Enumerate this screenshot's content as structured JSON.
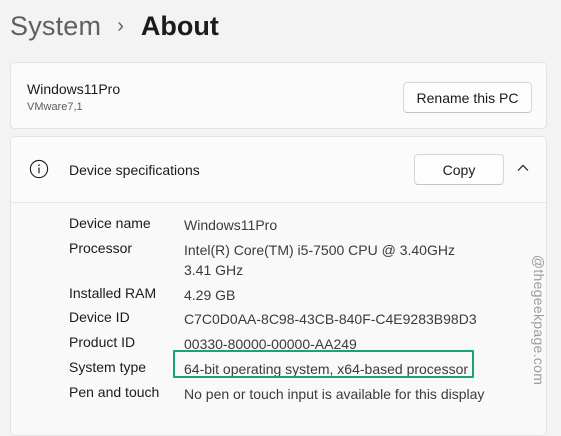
{
  "breadcrumb": {
    "parent": "System",
    "separator": "›",
    "current": "About"
  },
  "pc": {
    "name": "Windows11Pro",
    "model": "VMware7,1",
    "rename_label": "Rename this PC"
  },
  "device_specs": {
    "title": "Device specifications",
    "copy_label": "Copy",
    "rows": [
      {
        "label": "Device name",
        "value": "Windows11Pro"
      },
      {
        "label": "Processor",
        "value": "Intel(R) Core(TM) i5-7500 CPU @ 3.40GHz   3.41 GHz"
      },
      {
        "label": "Installed RAM",
        "value": "4.29 GB"
      },
      {
        "label": "Device ID",
        "value": "C7C0D0AA-8C98-43CB-840F-C4E9283B98D3"
      },
      {
        "label": "Product ID",
        "value": "00330-80000-00000-AA249"
      },
      {
        "label": "System type",
        "value": "64-bit operating system, x64-based processor"
      },
      {
        "label": "Pen and touch",
        "value": "No pen or touch input is available for this display"
      }
    ]
  },
  "watermark": "@thegeekpage.com",
  "colors": {
    "highlight": "#1aa37a"
  },
  "icons": {
    "info": "info-circle-icon",
    "collapse": "chevron-up-icon"
  }
}
